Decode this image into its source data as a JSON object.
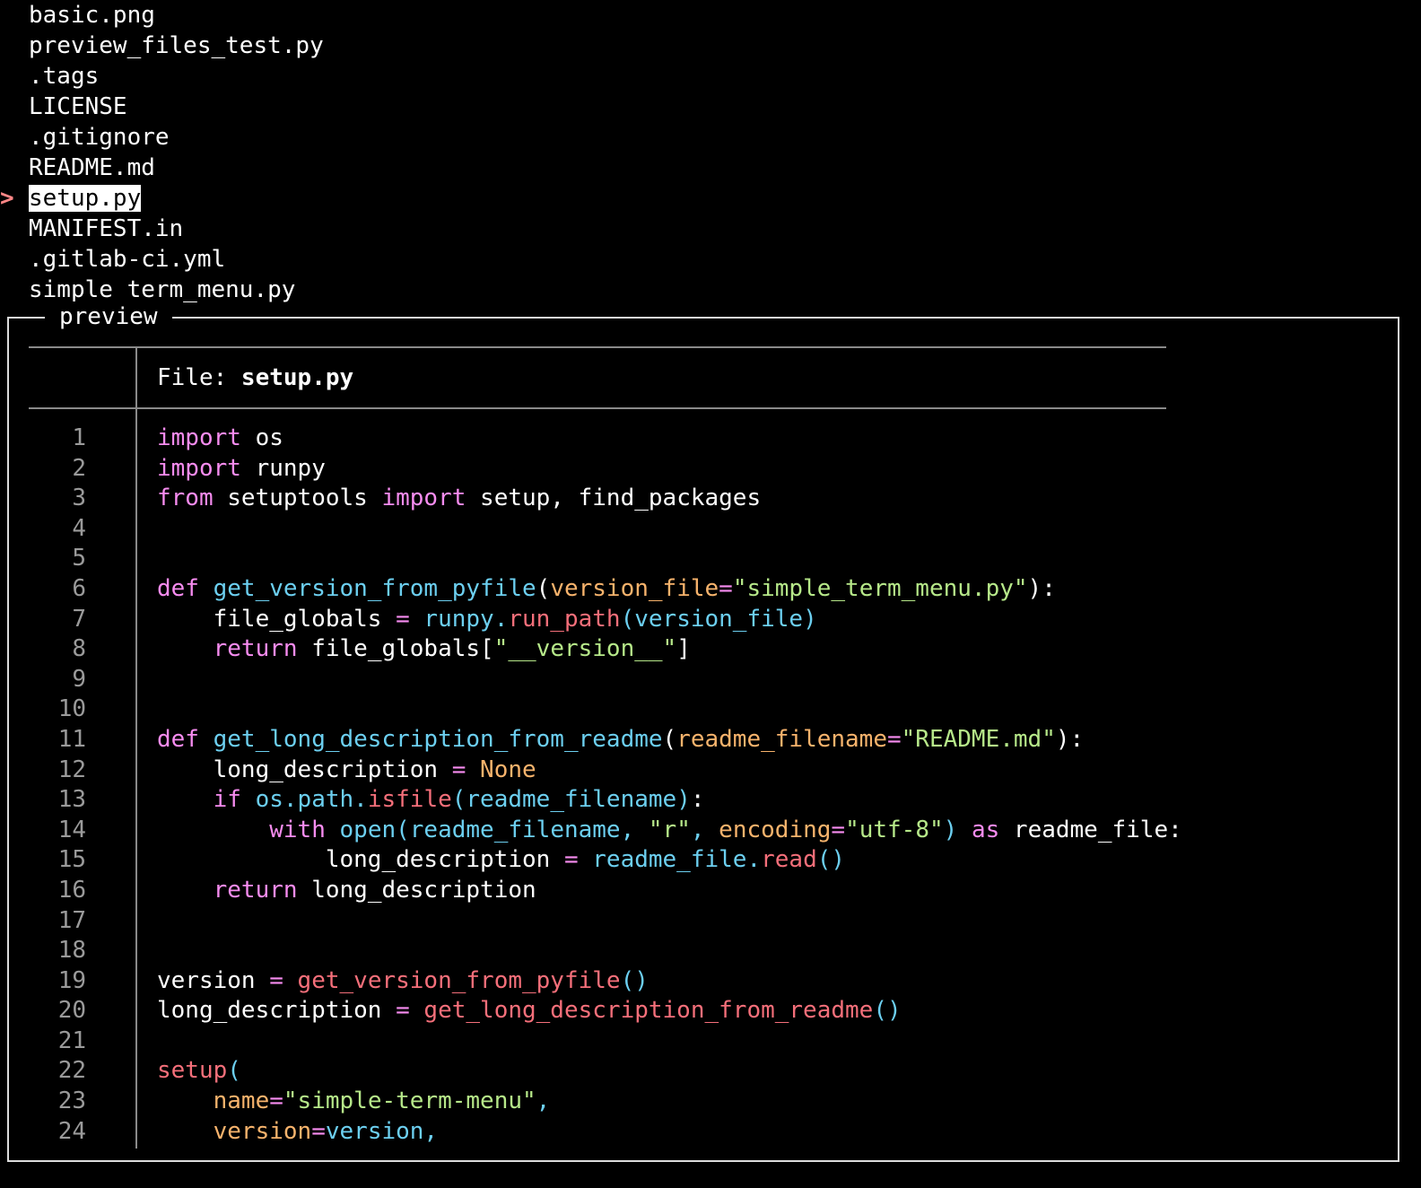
{
  "menu": {
    "cursor": ">",
    "entries": [
      "basic.png",
      "preview_files_test.py",
      ".tags",
      "LICENSE",
      ".gitignore",
      "README.md",
      "setup.py",
      "MANIFEST.in",
      ".gitlab-ci.yml",
      "simple_term_menu.py"
    ],
    "selected_index": 6
  },
  "preview": {
    "title": "preview",
    "file_label": "File: ",
    "file_name": "setup.py",
    "lines": [
      [
        [
          "kw",
          "import"
        ],
        [
          "plain",
          " os"
        ]
      ],
      [
        [
          "kw",
          "import"
        ],
        [
          "plain",
          " runpy"
        ]
      ],
      [
        [
          "kw",
          "from"
        ],
        [
          "plain",
          " setuptools "
        ],
        [
          "kw",
          "import"
        ],
        [
          "plain",
          " setup, find_packages"
        ]
      ],
      [],
      [],
      [
        [
          "kw",
          "def"
        ],
        [
          "plain",
          " "
        ],
        [
          "fn",
          "get_version_from_pyfile"
        ],
        [
          "punc",
          "("
        ],
        [
          "param",
          "version_file"
        ],
        [
          "op",
          "="
        ],
        [
          "str",
          "\"simple_term_menu.py\""
        ],
        [
          "punc",
          "):"
        ]
      ],
      [
        [
          "plain",
          "    file_globals "
        ],
        [
          "op",
          "="
        ],
        [
          "plain",
          " "
        ],
        [
          "ident",
          "runpy."
        ],
        [
          "call",
          "run_path"
        ],
        [
          "ident",
          "(version_file)"
        ]
      ],
      [
        [
          "plain",
          "    "
        ],
        [
          "kw",
          "return"
        ],
        [
          "plain",
          " file_globals["
        ],
        [
          "str",
          "\"__version__\""
        ],
        [
          "plain",
          "]"
        ]
      ],
      [],
      [],
      [
        [
          "kw",
          "def"
        ],
        [
          "plain",
          " "
        ],
        [
          "fn",
          "get_long_description_from_readme"
        ],
        [
          "punc",
          "("
        ],
        [
          "param",
          "readme_filename"
        ],
        [
          "op",
          "="
        ],
        [
          "str",
          "\"README.md\""
        ],
        [
          "punc",
          "):"
        ]
      ],
      [
        [
          "plain",
          "    long_description "
        ],
        [
          "op",
          "="
        ],
        [
          "plain",
          " "
        ],
        [
          "param",
          "None"
        ]
      ],
      [
        [
          "plain",
          "    "
        ],
        [
          "kw",
          "if"
        ],
        [
          "plain",
          " "
        ],
        [
          "ident",
          "os.path."
        ],
        [
          "call",
          "isfile"
        ],
        [
          "ident",
          "(readme_filename)"
        ],
        [
          "punc",
          ":"
        ]
      ],
      [
        [
          "plain",
          "        "
        ],
        [
          "kw",
          "with"
        ],
        [
          "plain",
          " "
        ],
        [
          "ident",
          "open(readme_filename, "
        ],
        [
          "str",
          "\"r\""
        ],
        [
          "ident",
          ", "
        ],
        [
          "param",
          "encoding"
        ],
        [
          "op",
          "="
        ],
        [
          "str",
          "\"utf-8\""
        ],
        [
          "ident",
          ")"
        ],
        [
          "plain",
          " "
        ],
        [
          "kw",
          "as"
        ],
        [
          "plain",
          " readme_file:"
        ]
      ],
      [
        [
          "plain",
          "            long_description "
        ],
        [
          "op",
          "="
        ],
        [
          "plain",
          " "
        ],
        [
          "ident",
          "readme_file."
        ],
        [
          "call",
          "read"
        ],
        [
          "ident",
          "()"
        ]
      ],
      [
        [
          "plain",
          "    "
        ],
        [
          "kw",
          "return"
        ],
        [
          "plain",
          " long_description"
        ]
      ],
      [],
      [],
      [
        [
          "plain",
          "version "
        ],
        [
          "op",
          "="
        ],
        [
          "plain",
          " "
        ],
        [
          "call",
          "get_version_from_pyfile"
        ],
        [
          "ident",
          "()"
        ]
      ],
      [
        [
          "plain",
          "long_description "
        ],
        [
          "op",
          "="
        ],
        [
          "plain",
          " "
        ],
        [
          "call",
          "get_long_description_from_readme"
        ],
        [
          "ident",
          "()"
        ]
      ],
      [],
      [
        [
          "call",
          "setup"
        ],
        [
          "ident",
          "("
        ]
      ],
      [
        [
          "plain",
          "    "
        ],
        [
          "param",
          "name"
        ],
        [
          "op",
          "="
        ],
        [
          "str",
          "\"simple-term-menu\""
        ],
        [
          "ident",
          ","
        ]
      ],
      [
        [
          "plain",
          "    "
        ],
        [
          "param",
          "version"
        ],
        [
          "op",
          "="
        ],
        [
          "ident",
          "version,"
        ]
      ]
    ]
  },
  "colors": {
    "background": "#000000",
    "cursor": "#ff8787",
    "keyword": "#f78cf0",
    "function": "#6ccff0",
    "call": "#f56f7a",
    "string": "#b6e889",
    "parameter": "#f7b36c",
    "line_number": "#9a9a9a",
    "border": "#dcdcdc"
  }
}
